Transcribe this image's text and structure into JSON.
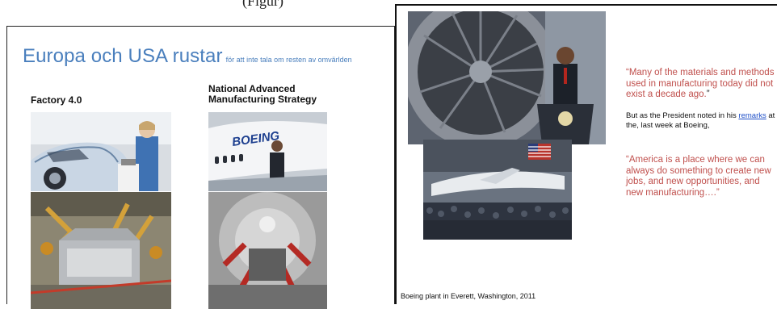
{
  "top_caption": "(Figur)",
  "left_slide": {
    "title_main": "Europa och USA rustar",
    "title_sub": "för att inte tala om resten av omvärlden",
    "col_left_heading": "Factory 4.0",
    "col_right_heading": "National Advanced Manufacturing Strategy",
    "photos": [
      "merkel-car-photo",
      "robot-assembly-line-photo",
      "boeing-jet-obama-photo",
      "robot-cell-photo"
    ]
  },
  "right_slide": {
    "quote1": "“Many of the materials and methods used in manufacturing today did not exist a decade ago.",
    "quote1_end": "”",
    "bridge_before": "But as the President noted in his ",
    "bridge_link": "remarks",
    "bridge_after": " at the, last week at Boeing,",
    "quote2": "“America is a place where we can always do something to create new jobs, and new opportunities, and new manufacturing….”",
    "caption": "Boeing plant in Everett, Washington, 2011"
  },
  "colors": {
    "title_blue": "#4a7fbd",
    "quote_red": "#c0504d",
    "link_blue": "#1f4fc8"
  }
}
